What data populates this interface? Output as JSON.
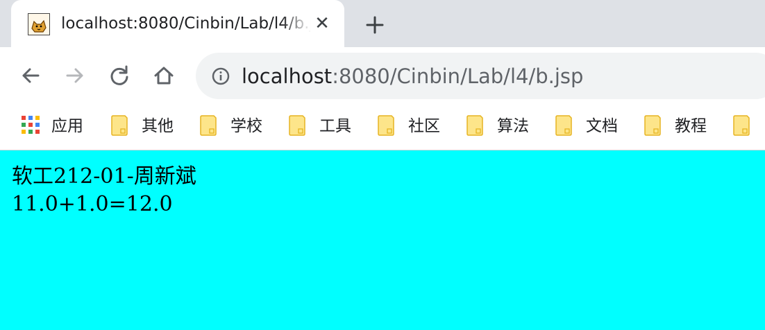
{
  "tab": {
    "title": "localhost:8080/Cinbin/Lab/l4/b.jsp",
    "favicon": "tomcat-icon",
    "close_glyph": "✕"
  },
  "toolbar": {
    "back_icon": "back-arrow-icon",
    "forward_icon": "forward-arrow-icon",
    "reload_icon": "reload-icon",
    "home_icon": "home-icon",
    "url_host": "localhost",
    "url_rest": ":8080/Cinbin/Lab/l4/b.jsp"
  },
  "bookmarks": {
    "apps_label": "应用",
    "items": [
      "其他",
      "学校",
      "工具",
      "社区",
      "算法",
      "文档",
      "教程"
    ]
  },
  "page": {
    "background": "#00ffff",
    "line1": "软工212-01-周新斌",
    "line2": "11.0+1.0=12.0"
  }
}
